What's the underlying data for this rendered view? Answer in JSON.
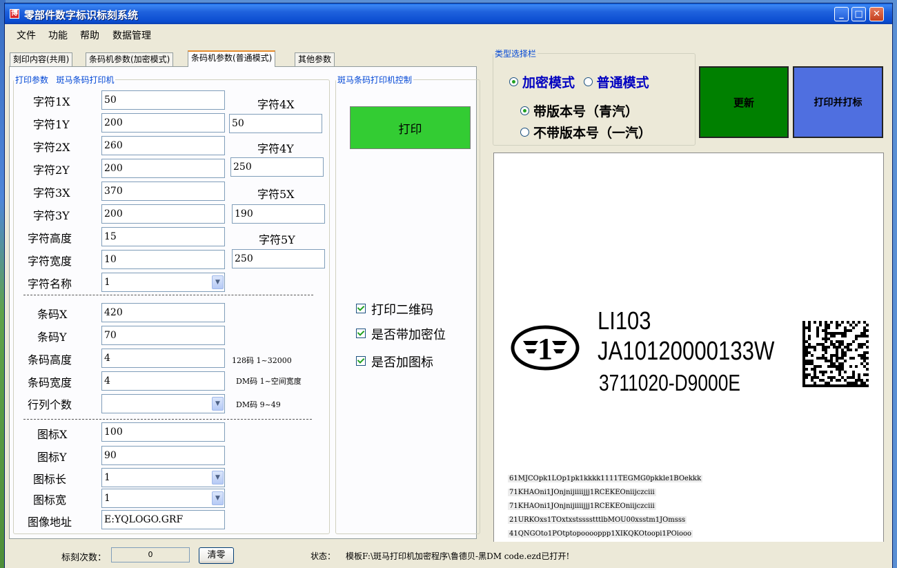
{
  "window": {
    "title": "零部件数字标识标刻系统",
    "app_icon": "博"
  },
  "menu": [
    "文件",
    "功能",
    "帮助",
    "数据管理"
  ],
  "tabs": [
    {
      "label": "刻印内容(共用)",
      "active": false
    },
    {
      "label": "条码机参数(加密模式)",
      "active": false
    },
    {
      "label": "条码机参数(普通模式)",
      "active": true
    },
    {
      "label": "其他参数",
      "active": false
    }
  ],
  "print_params": {
    "legend": "打印参数",
    "sub_legend": "斑马条码打印机",
    "char_rows": [
      {
        "label": "字符1X",
        "value": "50"
      },
      {
        "label": "字符1Y",
        "value": "200"
      },
      {
        "label": "字符2X",
        "value": "260"
      },
      {
        "label": "字符2Y",
        "value": "200"
      },
      {
        "label": "字符3X",
        "value": "370"
      },
      {
        "label": "字符3Y",
        "value": "200"
      },
      {
        "label": "字符高度",
        "value": "15"
      },
      {
        "label": "字符宽度",
        "value": "10"
      }
    ],
    "right_rows": [
      {
        "label": "字符4X",
        "value": "50"
      },
      {
        "label": "字符4Y",
        "value": "250"
      },
      {
        "label": "字符5X",
        "value": "190"
      },
      {
        "label": "字符5Y",
        "value": "250"
      }
    ],
    "char_name": {
      "label": "字符名称",
      "value": "1"
    },
    "barcode_rows": [
      {
        "label": "条码X",
        "value": "420"
      },
      {
        "label": "条码Y",
        "value": "70"
      },
      {
        "label": "条码高度",
        "value": "4",
        "hint": "128码  1~32000"
      },
      {
        "label": "条码宽度",
        "value": "4",
        "hint": "DM码  1~空间宽度"
      }
    ],
    "row_col": {
      "label": "行列个数",
      "value": "",
      "hint": "DM码  9~49"
    },
    "icon_rows": [
      {
        "label": "图标X",
        "value": "100",
        "type": "text"
      },
      {
        "label": "图标Y",
        "value": "90",
        "type": "text"
      },
      {
        "label": "图标长",
        "value": "1",
        "type": "combo"
      },
      {
        "label": "图标宽",
        "value": "1",
        "type": "combo"
      },
      {
        "label": "图像地址",
        "value": "E:YQLOGO.GRF",
        "type": "text"
      }
    ]
  },
  "printer_control": {
    "legend": "斑马条码打印机控制",
    "print_button": "打印",
    "print_button_color": "#33cc33",
    "checks": [
      "打印二维码",
      "是否带加密位",
      "是否加图标"
    ]
  },
  "type_select": {
    "legend": "类型选择栏",
    "mode_encrypt": "加密模式",
    "mode_normal": "普通模式",
    "with_version": "带版本号（青汽）",
    "without_version": "不带版本号（一汽）"
  },
  "actions": {
    "update": "更新",
    "update_color": "#008000",
    "print_mark": "打印并打标",
    "print_mark_color": "#4f6fe0"
  },
  "label_preview": {
    "line1": "LI103",
    "line2": "JA10120000133W",
    "line3": "3711020-D9000E",
    "logo_glyph": "1",
    "code_lines": [
      "61MJCOpk1LOp1pk1kkkk1111TEGMG0pkkle1BOekkk",
      "71KHAOni1JOnjnijiiiijjj1RCEKEOniijczciii",
      "71KHAOni1JOnjnijiiiijjj1RCEKEOniijczciii",
      "21URKOxs1TOxtxstsssstttlbMOU00xsstm1JOmsss",
      "41QNGOto1POtptopooooppp1XIKQKOtoopi1POiooo"
    ]
  },
  "status": {
    "count_label": "标刻次数：",
    "count_value": "0",
    "clear_button": "清零",
    "state_label": "状态：",
    "state_text": "模板F:\\斑马打印机加密程序\\鲁德贝-黑DM code.ezd已打开!"
  }
}
